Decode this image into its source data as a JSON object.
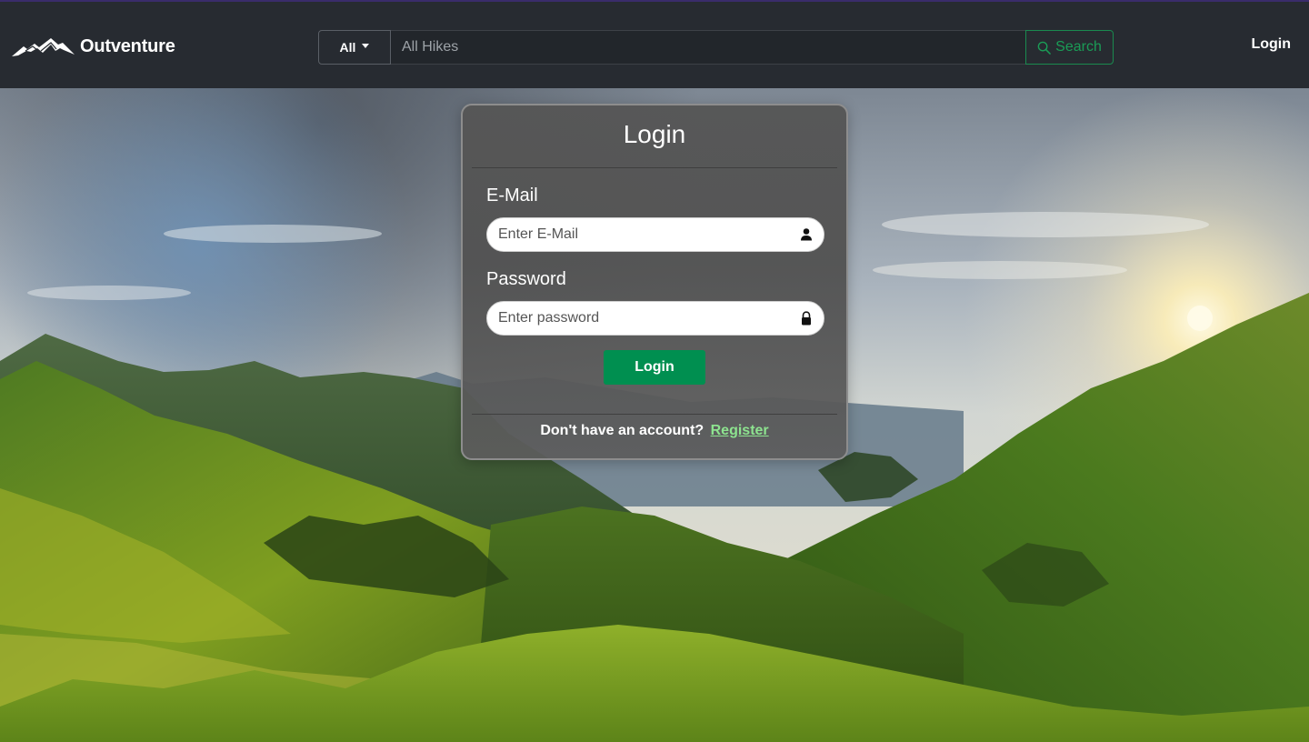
{
  "navbar": {
    "brand_name": "Outventure",
    "filter_label": "All",
    "search_placeholder": "All Hikes",
    "search_button_label": "Search",
    "login_link_label": "Login"
  },
  "login_card": {
    "title": "Login",
    "email_label": "E-Mail",
    "email_placeholder": "Enter E-Mail",
    "password_label": "Password",
    "password_placeholder": "Enter password",
    "submit_label": "Login",
    "no_account_text": "Don't have an account?",
    "register_link_label": "Register"
  },
  "icons": {
    "logo": "mountain-logo-icon",
    "filter_dropdown": "caret-down-icon",
    "search_button": "search-icon",
    "email_field": "user-icon",
    "password_field": "lock-icon"
  },
  "colors": {
    "navbar_bg": "#272b31",
    "accent_green": "#008f50",
    "search_green": "#1a9c56",
    "register_link": "#8de38f",
    "card_bg": "#555555"
  }
}
